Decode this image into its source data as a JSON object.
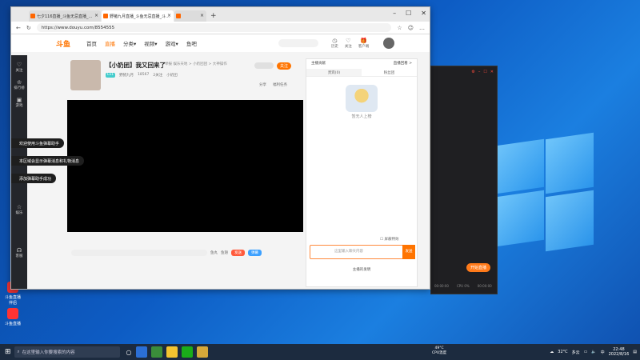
{
  "browser": {
    "tabs": [
      {
        "label": "七夕116直播_斗鱼无忌直播_…"
      },
      {
        "label": "野猪九月直播_斗鱼无忌直播_斗…"
      },
      {
        "label": ""
      }
    ],
    "url": "https://www.douyu.com/8554555"
  },
  "site": {
    "logo": "斗鱼",
    "nav": [
      "首页",
      "直播",
      "分类▾",
      "视频▾",
      "游戏▾",
      "鱼吧"
    ],
    "tools": [
      {
        "icon": "clock-icon",
        "label": "历史"
      },
      {
        "icon": "heart-icon",
        "label": "关注"
      },
      {
        "icon": "gift-icon",
        "label": "客户端"
      }
    ]
  },
  "sidebar": {
    "items": [
      "关注",
      "排行榜",
      "游戏",
      "娱乐",
      "客服"
    ]
  },
  "room": {
    "title": "【小奶团】我又回来了",
    "tag": "举报",
    "category": "娱乐天地 > 小奶团团 > 大神操作",
    "level": "Lv1",
    "anchor": "野猪九月",
    "heat": "18567",
    "fans": "2关注",
    "group": "小奶团",
    "follow": "关注",
    "share": "分享",
    "report": "福利任务"
  },
  "controls": {
    "label1": "鱼丸",
    "label2": "鱼翅",
    "send_red": "发送",
    "send_blue": "弹幕"
  },
  "chat": {
    "left_top": "主播贡献",
    "right_top": "直播回看 >",
    "tabs": [
      "贵宾(0)",
      "粉丝团"
    ],
    "empty_text": "暂无人上榜",
    "toggle": "屏蔽特效",
    "input_placeholder": "这里输入聊天内容",
    "send": "发送",
    "bottom": "主播的发明"
  },
  "toasts": [
    "欢迎使用斗鱼弹幕助手",
    "本区域会显示弹幕消息和礼物消息",
    "添加弹幕助手成功"
  ],
  "obs": {
    "start_live": "开始直播",
    "foot": [
      "00:00:00",
      "CPU 0%",
      "00:00:00"
    ]
  },
  "desktop_icons": [
    "斗鱼直播伴侣",
    "斗鱼直播"
  ],
  "taskbar": {
    "search_placeholder": "在这里输入你要搜索的内容",
    "cpu": "49°C",
    "cpu_label": "CPU温度",
    "weather": "32°C",
    "weather_label": "多云",
    "time": "22:48",
    "date": "2022/8/16"
  }
}
